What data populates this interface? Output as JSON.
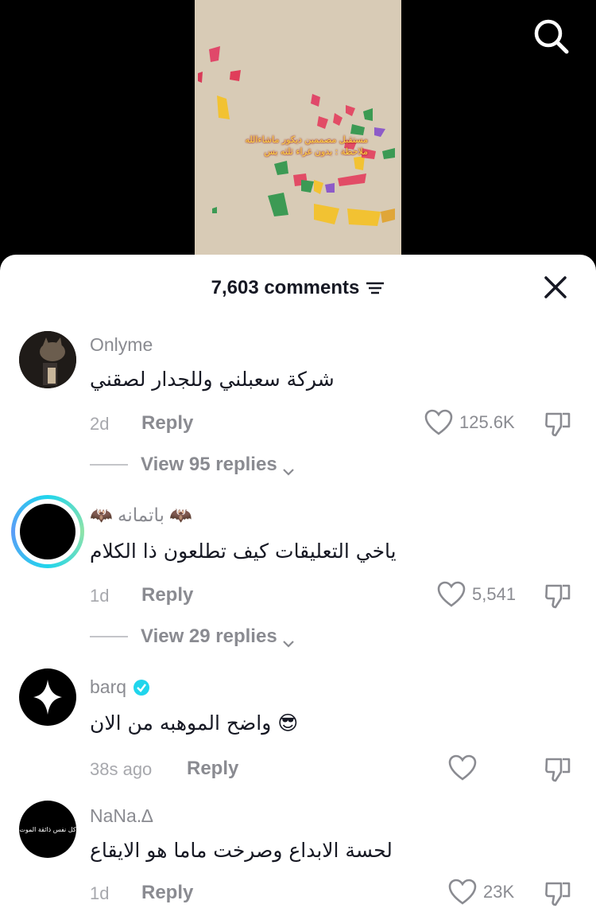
{
  "video": {
    "caption_line1": "مستقبل مصممين ديكور ماشاءالله",
    "caption_line2": "ملاحظة : بدون غراء ثلثه بس"
  },
  "comments_sheet": {
    "count_label": "7,603 comments"
  },
  "comments": [
    {
      "username": "Onlyme",
      "text": "شركة سعبلني وللجدار لصقني",
      "time": "2d",
      "reply": "Reply",
      "likes": "125.6K",
      "view_replies": "View 95 replies"
    },
    {
      "username": "🦇 باتمانه 🦇",
      "text": "ياخي التعليقات كيف تطلعون ذا الكلام",
      "time": "1d",
      "reply": "Reply",
      "likes": "5,541",
      "view_replies": "View 29 replies"
    },
    {
      "username": "barq",
      "text": "واضح الموهبه من الان 😎",
      "time": "38s ago",
      "reply": "Reply",
      "likes": ""
    },
    {
      "username": "NaNa.∆",
      "avatar_text": "كل نفس ذائقة الموت",
      "text": "لحسة الابداع وصرخت ماما هو الايقاع",
      "time": "1d",
      "reply": "Reply",
      "likes": "23K"
    }
  ],
  "colors": {
    "accent_verified": "#20d5ec",
    "text_primary": "#161823",
    "text_secondary": "#8a8b91"
  }
}
